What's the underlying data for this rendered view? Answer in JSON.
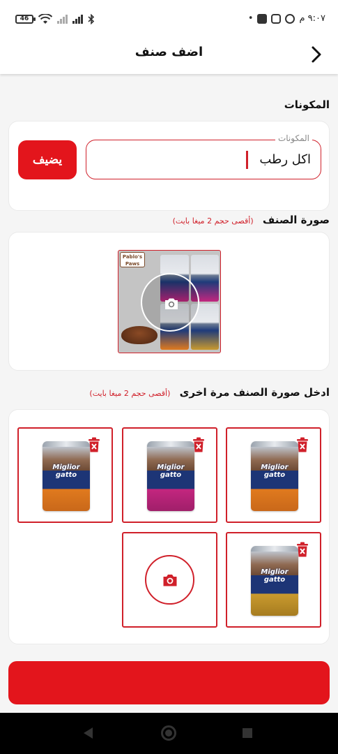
{
  "status_bar": {
    "battery_level": "46",
    "time": "٩:٠٧ م",
    "notification_dot": "•"
  },
  "header": {
    "title": "اضف صنف",
    "back_icon": "chevron-right-icon"
  },
  "ingredients": {
    "section_label": "المكونات",
    "field_label": "المكونات",
    "field_value": "اكل رطب",
    "add_button_label": "يضيف"
  },
  "product_image": {
    "section_label": "صورة الصنف",
    "hint": "(أقصى حجم 2 ميغا بايت)",
    "brand_tag": "Pablo's Paws",
    "overlay_icon": "camera-icon"
  },
  "extra_images": {
    "section_label": "ادخل صورة الصنف مرة اخرى",
    "hint": "(أقصى حجم 2 ميغا بايت)",
    "items": [
      {
        "brand": "Miglior gatto",
        "variant": "orange",
        "delete_icon": "trash-icon"
      },
      {
        "brand": "Miglior gatto",
        "variant": "pink",
        "delete_icon": "trash-icon"
      },
      {
        "brand": "Miglior gatto",
        "variant": "orange",
        "delete_icon": "trash-icon"
      },
      {
        "brand": "Miglior gatto",
        "variant": "gold",
        "delete_icon": "trash-icon"
      }
    ],
    "add_tile_icon": "camera-icon"
  },
  "colors": {
    "accent": "#e3151c",
    "border_accent": "#d0202a",
    "background": "#f5f5f5"
  }
}
